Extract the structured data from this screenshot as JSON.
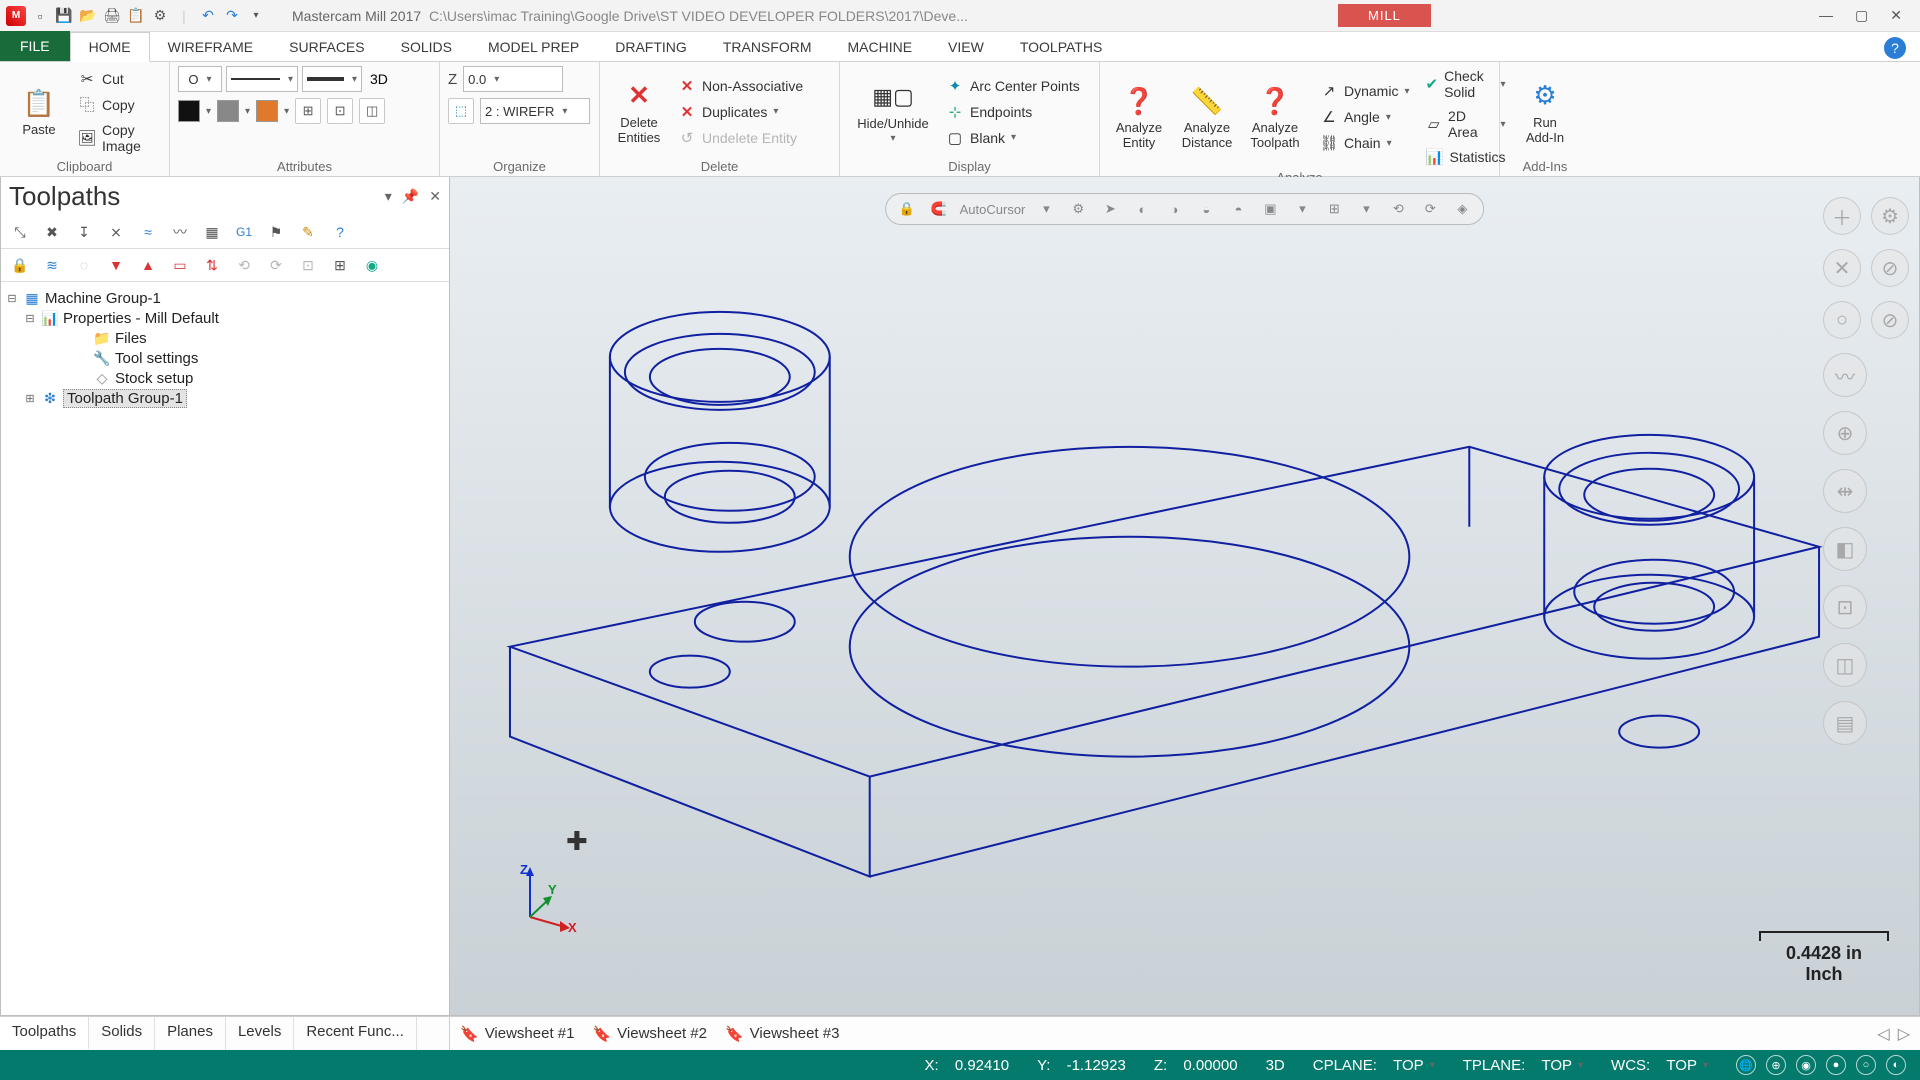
{
  "title": {
    "app": "Mastercam Mill 2017",
    "path": "C:\\Users\\imac Training\\Google Drive\\ST VIDEO DEVELOPER FOLDERS\\2017\\Deve...",
    "context_tab": "MILL"
  },
  "tabs": {
    "file": "FILE",
    "items": [
      "HOME",
      "WIREFRAME",
      "SURFACES",
      "SOLIDS",
      "MODEL PREP",
      "DRAFTING",
      "TRANSFORM",
      "MACHINE",
      "VIEW",
      "TOOLPATHS"
    ],
    "active": "HOME"
  },
  "ribbon": {
    "clipboard": {
      "label": "Clipboard",
      "paste": "Paste",
      "cut": "Cut",
      "copy": "Copy",
      "copy_image": "Copy Image"
    },
    "attributes": {
      "label": "Attributes",
      "mode3d": "3D",
      "pointstyle": "O"
    },
    "organize": {
      "label": "Organize",
      "z_label": "Z",
      "z_value": "0.0",
      "level_value": "2 : WIREFR"
    },
    "delete": {
      "label": "Delete",
      "delete_entities": "Delete\nEntities",
      "non_assoc": "Non-Associative",
      "duplicates": "Duplicates",
      "undelete": "Undelete Entity"
    },
    "display": {
      "label": "Display",
      "hide": "Hide/Unhide",
      "arc_center": "Arc Center Points",
      "endpoints": "Endpoints",
      "blank": "Blank"
    },
    "analyze": {
      "label": "Analyze",
      "entity": "Analyze\nEntity",
      "distance": "Analyze\nDistance",
      "toolpath": "Analyze\nToolpath",
      "dynamic": "Dynamic",
      "angle": "Angle",
      "chain": "Chain",
      "check_solid": "Check Solid",
      "area2d": "2D Area",
      "statistics": "Statistics"
    },
    "addins": {
      "label": "Add-Ins",
      "run": "Run\nAdd-In"
    }
  },
  "panel": {
    "title": "Toolpaths",
    "tree": {
      "root": "Machine Group-1",
      "props": "Properties - Mill Default",
      "files": "Files",
      "tool_settings": "Tool settings",
      "stock": "Stock setup",
      "tp_group": "Toolpath Group-1"
    }
  },
  "autocursor_label": "AutoCursor",
  "scale": {
    "value": "0.4428 in",
    "unit": "Inch"
  },
  "bottom_tabs": {
    "left": [
      "Toolpaths",
      "Solids",
      "Planes",
      "Levels",
      "Recent Func..."
    ],
    "left_active": "Toolpaths",
    "sheets": [
      "Viewsheet #1",
      "Viewsheet #2",
      "Viewsheet #3"
    ]
  },
  "status": {
    "x_label": "X:",
    "x": "0.92410",
    "y_label": "Y:",
    "y": "-1.12923",
    "z_label": "Z:",
    "z": "0.00000",
    "mode": "3D",
    "cplane_label": "CPLANE:",
    "cplane": "TOP",
    "tplane_label": "TPLANE:",
    "tplane": "TOP",
    "wcs_label": "WCS:",
    "wcs": "TOP"
  }
}
